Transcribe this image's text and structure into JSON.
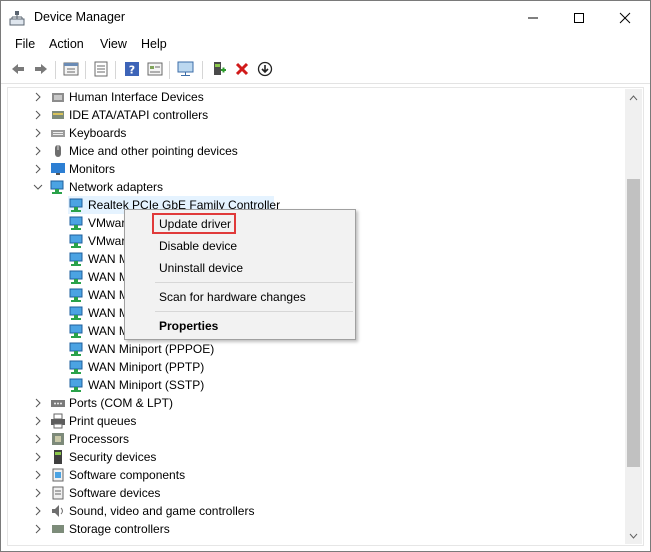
{
  "window": {
    "title": "Device Manager",
    "controls": {
      "minimize": "─",
      "maximize": "☐",
      "close": "✕"
    }
  },
  "menu": [
    "File",
    "Action",
    "View",
    "Help"
  ],
  "toolbar": {
    "icons": [
      "back-arrow-icon",
      "forward-arrow-icon",
      "device-tree-icon",
      "properties-icon",
      "help-icon",
      "view-icon",
      "monitor-scan-icon",
      "add-driver-icon",
      "uninstall-icon",
      "download-icon"
    ]
  },
  "tree": {
    "categories_top": [
      "Human Interface Devices",
      "IDE ATA/ATAPI controllers",
      "Keyboards",
      "Mice and other pointing devices",
      "Monitors"
    ],
    "expanded": {
      "label": "Network adapters",
      "children": [
        "Realtek PCIe GbE Family Controller",
        "VMwar",
        "VMwar",
        "WAN M",
        "WAN M",
        "WAN M",
        "WAN M",
        "WAN M",
        "WAN Miniport (PPPOE)",
        "WAN Miniport (PPTP)",
        "WAN Miniport (SSTP)"
      ],
      "selected_index": 0
    },
    "categories_bottom": [
      "Ports (COM & LPT)",
      "Print queues",
      "Processors",
      "Security devices",
      "Software components",
      "Software devices",
      "Sound, video and game controllers",
      "Storage controllers"
    ]
  },
  "context_menu": {
    "items": [
      {
        "label": "Update driver",
        "highlighted": true
      },
      {
        "label": "Disable device"
      },
      {
        "label": "Uninstall device"
      },
      {
        "label": "Scan for hardware changes"
      },
      {
        "label": "Properties",
        "bold": true
      }
    ]
  },
  "colors": {
    "selection": "#e5f3ff",
    "highlight_box": "#e03a3a",
    "menu_bg": "#f2f2f2"
  }
}
